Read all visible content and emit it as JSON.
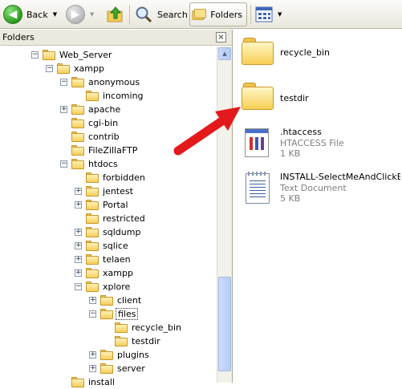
{
  "toolbar": {
    "back_label": "Back",
    "search_label": "Search",
    "folders_label": "Folders"
  },
  "pane": {
    "title": "Folders",
    "close_glyph": "×"
  },
  "tree": [
    {
      "label": "Web_Server",
      "level": 0,
      "expander": "−"
    },
    {
      "label": "xampp",
      "level": 1,
      "expander": "−"
    },
    {
      "label": "anonymous",
      "level": 2,
      "expander": "−"
    },
    {
      "label": "incoming",
      "level": 3,
      "expander": ""
    },
    {
      "label": "apache",
      "level": 2,
      "expander": "+"
    },
    {
      "label": "cgi-bin",
      "level": 2,
      "expander": ""
    },
    {
      "label": "contrib",
      "level": 2,
      "expander": ""
    },
    {
      "label": "FileZillaFTP",
      "level": 2,
      "expander": ""
    },
    {
      "label": "htdocs",
      "level": 2,
      "expander": "−"
    },
    {
      "label": "forbidden",
      "level": 3,
      "expander": ""
    },
    {
      "label": "jentest",
      "level": 3,
      "expander": "+"
    },
    {
      "label": "Portal",
      "level": 3,
      "expander": "+"
    },
    {
      "label": "restricted",
      "level": 3,
      "expander": ""
    },
    {
      "label": "sqldump",
      "level": 3,
      "expander": "+"
    },
    {
      "label": "sqlice",
      "level": 3,
      "expander": "+"
    },
    {
      "label": "telaen",
      "level": 3,
      "expander": "+"
    },
    {
      "label": "xampp",
      "level": 3,
      "expander": "+"
    },
    {
      "label": "xplore",
      "level": 3,
      "expander": "−"
    },
    {
      "label": "client",
      "level": 4,
      "expander": "+"
    },
    {
      "label": "files",
      "level": 4,
      "expander": "−",
      "selected": true
    },
    {
      "label": "recycle_bin",
      "level": 5,
      "expander": ""
    },
    {
      "label": "testdir",
      "level": 5,
      "expander": ""
    },
    {
      "label": "plugins",
      "level": 4,
      "expander": "+"
    },
    {
      "label": "server",
      "level": 4,
      "expander": "+"
    },
    {
      "label": "install",
      "level": 2,
      "expander": ""
    }
  ],
  "files": {
    "recycle_bin": {
      "name": "recycle_bin"
    },
    "testdir": {
      "name": "testdir"
    },
    "htaccess": {
      "name": ".htaccess",
      "type": "HTACCESS File",
      "size": "1 KB"
    },
    "install_doc": {
      "name": "INSTALL-SelectMeAndClickEdit...",
      "type": "Text Document",
      "size": "5 KB"
    }
  },
  "colors": {
    "arrow": "#e3191c",
    "selection_border": "#333333"
  }
}
